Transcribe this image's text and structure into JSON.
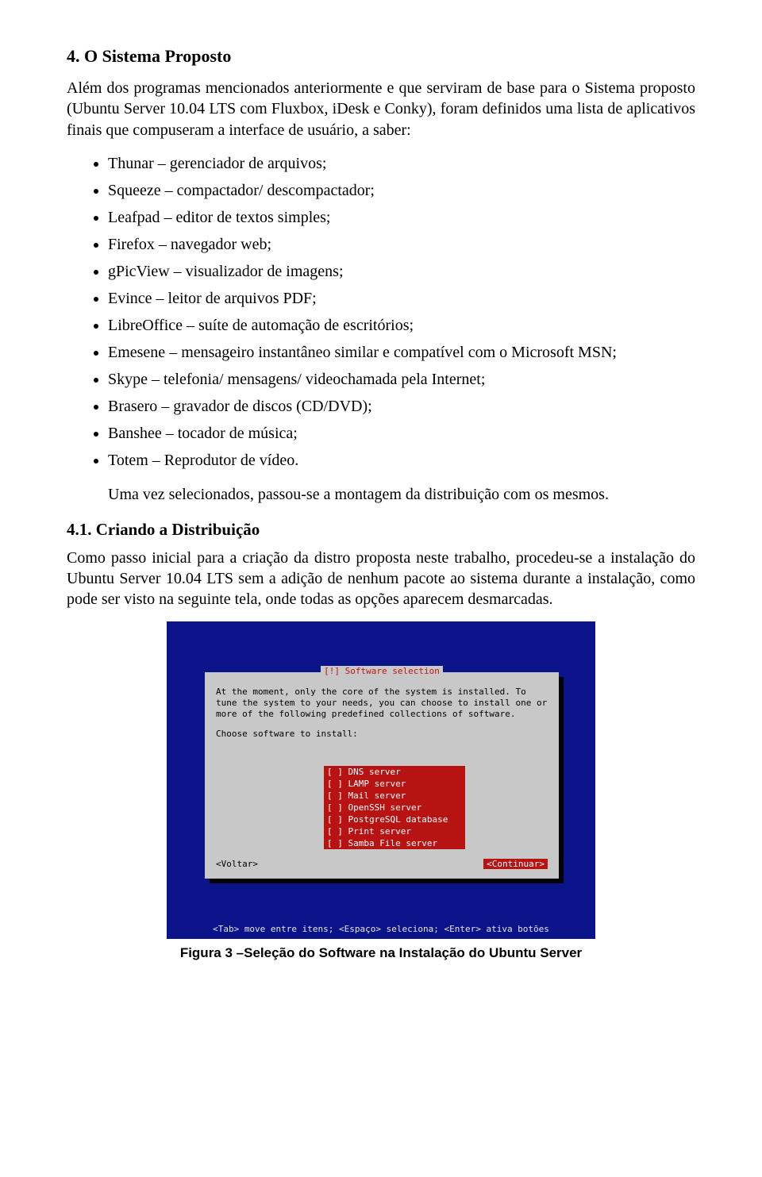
{
  "section": {
    "number_title": "4. O Sistema Proposto",
    "intro": "Além dos programas mencionados anteriormente e que serviram de base para o Sistema proposto (Ubuntu Server 10.04 LTS com Fluxbox, iDesk e Conky), foram definidos uma lista de aplicativos finais que compuseram a interface de usuário, a saber:",
    "bullets": [
      "Thunar – gerenciador de arquivos;",
      "Squeeze – compactador/ descompactador;",
      "Leafpad – editor de textos simples;",
      "Firefox – navegador web;",
      "gPicView – visualizador de imagens;",
      "Evince – leitor de arquivos PDF;",
      "LibreOffice – suíte de automação de escritórios;",
      "Emesene – mensageiro instantâneo similar e compatível com o Microsoft MSN;",
      "Skype – telefonia/ mensagens/ videochamada pela Internet;",
      "Brasero – gravador de discos (CD/DVD);",
      "Banshee – tocador de música;",
      "Totem – Reprodutor de vídeo."
    ],
    "after_list": "Uma vez selecionados, passou-se a montagem da distribuição com os mesmos."
  },
  "subsection": {
    "title": "4.1. Criando a Distribuição",
    "para": "Como passo inicial para a criação da distro proposta neste trabalho, procedeu-se a instalação do Ubuntu Server 10.04 LTS sem a adição de nenhum pacote ao sistema durante a instalação, como pode ser visto na seguinte tela, onde todas as opções aparecem desmarcadas."
  },
  "installer": {
    "title": "[!] Software selection",
    "desc": "At the moment, only the core of the system is installed. To tune the system to your needs, you can choose to install one or more of the following predefined collections of software.",
    "choose": "Choose software to install:",
    "options": [
      "[ ] DNS server",
      "[ ] LAMP server",
      "[ ] Mail server",
      "[ ] OpenSSH server",
      "[ ] PostgreSQL database",
      "[ ] Print server",
      "[ ] Samba File server"
    ],
    "back": "<Voltar>",
    "continue": "<Continuar>",
    "hint": "<Tab> move entre itens; <Espaço> seleciona; <Enter> ativa botões"
  },
  "figure_caption": "Figura 3 –Seleção do Software na Instalação do Ubuntu Server"
}
